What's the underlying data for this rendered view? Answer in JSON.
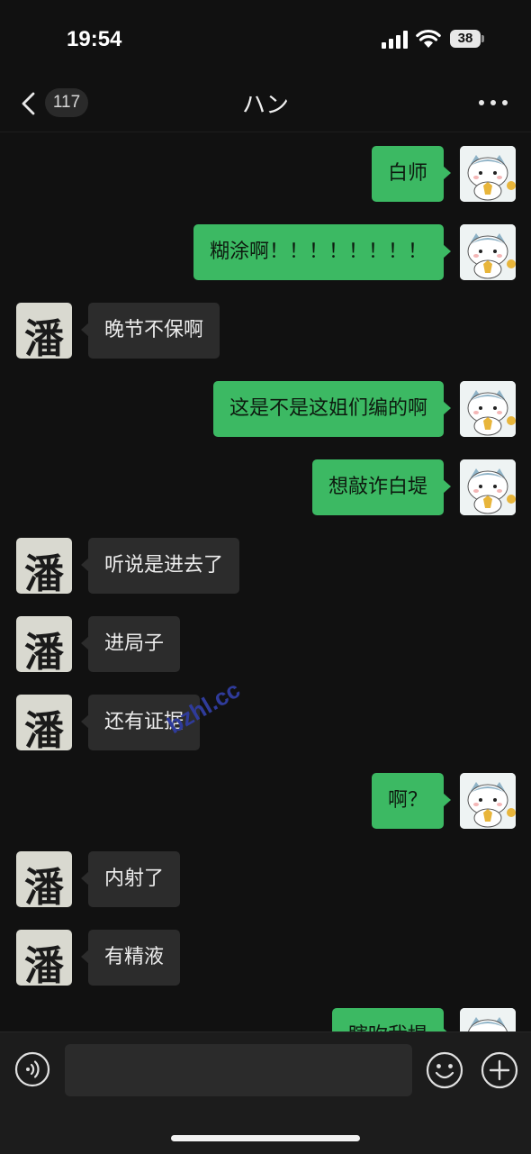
{
  "status": {
    "time": "19:54",
    "battery": "38"
  },
  "nav": {
    "unread_count": "117",
    "title": "ハン"
  },
  "messages": [
    {
      "side": "out",
      "text": "白师"
    },
    {
      "side": "out",
      "text": "糊涂啊！！！！！！！！"
    },
    {
      "side": "in",
      "text": "晚节不保啊"
    },
    {
      "side": "out",
      "text": "这是不是这姐们编的啊"
    },
    {
      "side": "out",
      "text": "想敲诈白堤"
    },
    {
      "side": "in",
      "text": "听说是进去了"
    },
    {
      "side": "in",
      "text": "进局子"
    },
    {
      "side": "in",
      "text": "还有证据"
    },
    {
      "side": "out",
      "text": "啊？"
    },
    {
      "side": "in",
      "text": "内射了"
    },
    {
      "side": "in",
      "text": "有精液"
    },
    {
      "side": "out",
      "text": "瞎吹我堤"
    }
  ],
  "contact_avatar_glyph": "潘",
  "watermark": "bzhl.cc",
  "colors": {
    "outgoing_bubble": "#3cb963",
    "incoming_bubble": "#2c2c2c",
    "background": "#111111"
  }
}
